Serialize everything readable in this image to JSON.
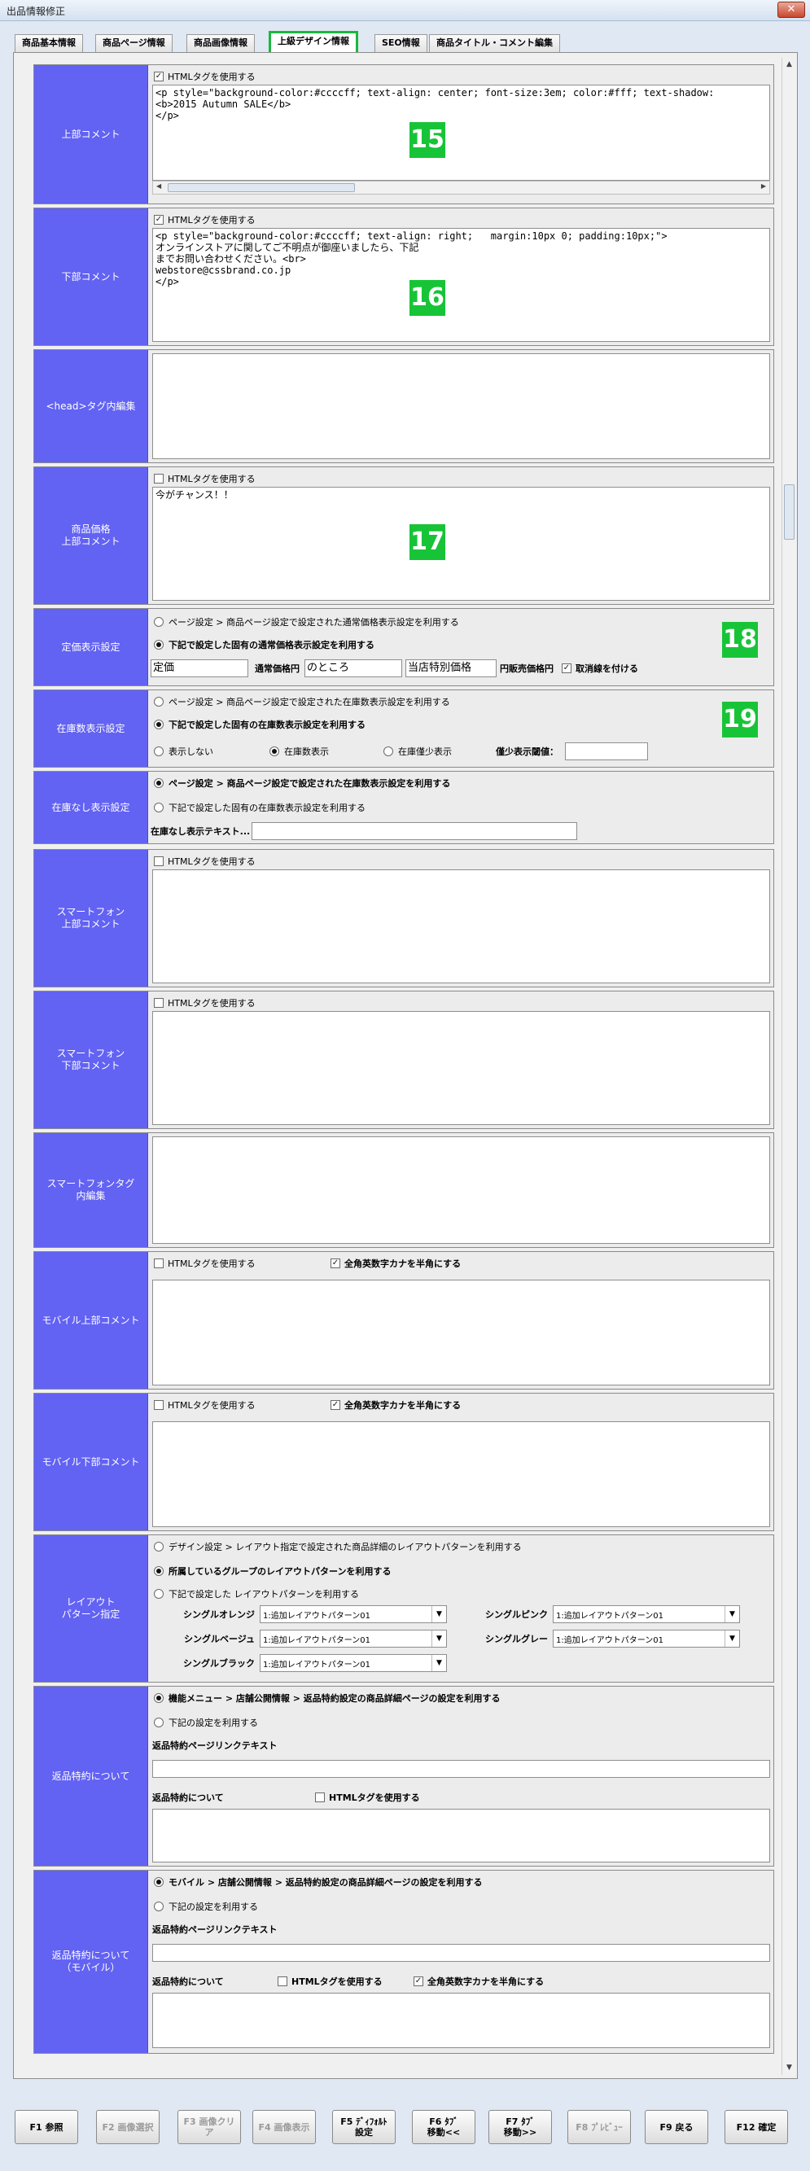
{
  "window": {
    "title": "出品情報修正",
    "close_label": "✕"
  },
  "tabs": [
    {
      "label": "商品基本情報"
    },
    {
      "label": "商品ページ情報"
    },
    {
      "label": "商品画像情報"
    },
    {
      "label": "上級デザイン情報"
    },
    {
      "label": "SEO情報"
    },
    {
      "label": "商品タイトル・コメント編集"
    }
  ],
  "common": {
    "use_html": "HTMLタグを使用する",
    "zenkaku": "全角英数字カナを半角にする"
  },
  "sections": {
    "top_comment": {
      "label": "上部コメント",
      "value": "<p style=\"background-color:#ccccff; text-align: center; font-size:3em; color:#fff; text-shadow:\n<b>2015 Autumn SALE</b>\n</p>",
      "badge": "15"
    },
    "bottom_comment": {
      "label": "下部コメント",
      "value": "<p style=\"background-color:#ccccff; text-align: right;   margin:10px 0; padding:10px;\">\nオンラインストアに関してご不明点が御座いましたら、下記\nまでお問い合わせください。<br>\nwebstore@cssbrand.co.jp\n</p>",
      "badge": "16"
    },
    "head_tag": {
      "label": "<head>タグ内編集",
      "value": ""
    },
    "price_comment": {
      "label": "商品価格\n上部コメント",
      "value": "今がチャンス！！",
      "badge": "17"
    },
    "price_display": {
      "label": "定価表示設定",
      "opt1": "ページ設定 > 商品ページ設定で設定された通常価格表示設定を利用する",
      "opt2": "下記で設定した固有の通常価格表示設定を利用する",
      "f1": "定価",
      "f1_label": "通常価格円",
      "f2": "のところ",
      "f3": "当店特別価格",
      "f3_label": "円販売価格円",
      "strike": "取消線を付ける",
      "badge": "18"
    },
    "stock_display": {
      "label": "在庫数表示設定",
      "opt1": "ページ設定 > 商品ページ設定で設定された在庫数表示設定を利用する",
      "opt2": "下記で設定した固有の在庫数表示設定を利用する",
      "r1": "表示しない",
      "r2": "在庫数表示",
      "r3": "在庫僅少表示",
      "threshold": "僅少表示閾値：",
      "badge": "19"
    },
    "no_stock": {
      "label": "在庫なし表示設定",
      "opt1": "ページ設定 > 商品ページ設定で設定された在庫数表示設定を利用する",
      "opt2": "下記で設定した固有の在庫数表示設定を利用する",
      "text_label": "在庫なし表示テキスト..."
    },
    "sp_top": {
      "label": "スマートフォン\n上部コメント"
    },
    "sp_bottom": {
      "label": "スマートフォン\n下部コメント"
    },
    "sp_tag": {
      "label": "スマートフォンタグ\n内編集"
    },
    "mobile_top": {
      "label": "モバイル上部コメント"
    },
    "mobile_bottom": {
      "label": "モバイル下部コメント"
    },
    "layout": {
      "label": "レイアウト\nパターン指定",
      "opt1": "デザイン設定 > レイアウト指定で設定された商品詳細のレイアウトパターンを利用する",
      "opt2": "所属しているグループのレイアウトパターンを利用する",
      "opt3": "下記で設定した レイアウトパターンを利用する",
      "rows": [
        {
          "name": "シングルオレンジ",
          "value": "1:追加レイアウトパターン01"
        },
        {
          "name": "シングルピンク",
          "value": "1:追加レイアウトパターン01"
        },
        {
          "name": "シングルベージュ",
          "value": "1:追加レイアウトパターン01"
        },
        {
          "name": "シングルグレー",
          "value": "1:追加レイアウトパターン01"
        },
        {
          "name": "シングルブラック",
          "value": "1:追加レイアウトパターン01"
        }
      ]
    },
    "returns": {
      "label": "返品特約について",
      "opt1": "機能メニュー > 店舗公開情報 > 返品特約設定の商品詳細ページの設定を利用する",
      "opt2": "下記の設定を利用する",
      "link_label": "返品特約ページリンクテキスト",
      "about_label": "返品特約について"
    },
    "returns_mobile": {
      "label": "返品特約について\n（モバイル）",
      "opt1": "モバイル > 店舗公開情報 > 返品特約設定の商品詳細ページの設定を利用する",
      "opt2": "下記の設定を利用する",
      "link_label": "返品特約ページリンクテキスト",
      "about_label": "返品特約について"
    }
  },
  "footer": [
    {
      "label": "F1 参照",
      "enabled": true
    },
    {
      "label": "F2 画像選択",
      "enabled": false
    },
    {
      "label": "F3 画像クリア",
      "enabled": false
    },
    {
      "label": "F4 画像表示",
      "enabled": false
    },
    {
      "label": "F5 ﾃﾞｨﾌｫﾙﾄ\n設定",
      "enabled": true
    },
    {
      "label": "F6 ﾀﾌﾞ\n移動<<",
      "enabled": true
    },
    {
      "label": "F7 ﾀﾌﾞ\n移動>>",
      "enabled": true
    },
    {
      "label": "F8 ﾌﾟﾚﾋﾞｭｰ",
      "enabled": false
    },
    {
      "label": "F9 戻る",
      "enabled": true
    },
    {
      "label": "F12 確定",
      "enabled": true
    }
  ]
}
